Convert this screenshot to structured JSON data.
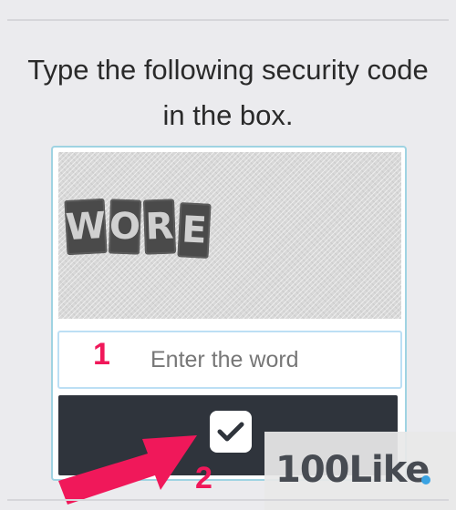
{
  "instruction": {
    "line1": "Type the following security code",
    "line2": "in the box."
  },
  "captcha": {
    "letters": [
      "W",
      "O",
      "R",
      "E"
    ]
  },
  "input": {
    "placeholder": "Enter the word",
    "value": ""
  },
  "submit": {
    "icon": "checkmark-icon"
  },
  "annotations": {
    "step1": "1",
    "step2": "2",
    "color": "#f0185a"
  },
  "watermark": {
    "text": "100Like",
    "dot_color": "#3aa3e3"
  }
}
